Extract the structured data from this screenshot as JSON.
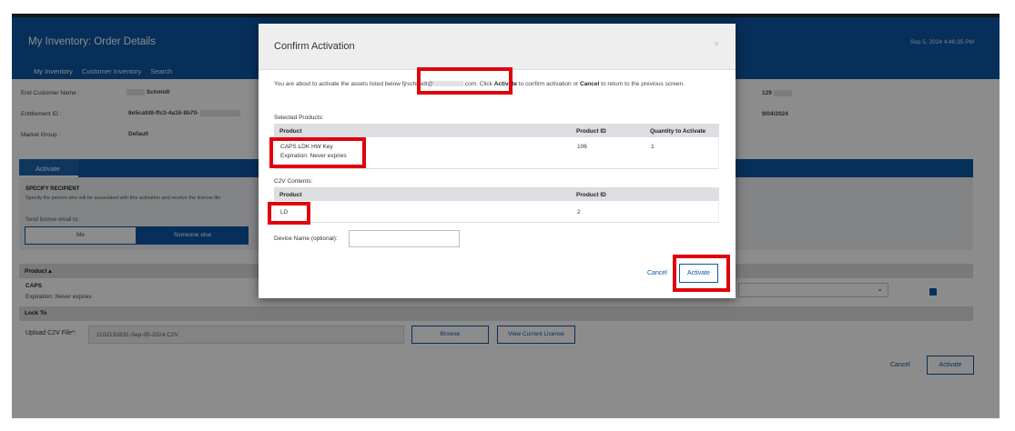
{
  "header": {
    "title": "My Inventory: Order Details",
    "datetime": "Sep 5, 2024 4:46:35 PM",
    "nav": [
      "My Inventory",
      "Customer Inventory",
      "Search"
    ]
  },
  "details": {
    "end_customer_label": "End Customer Name :",
    "end_customer_value": "Schmidt",
    "entitlement_label": "Entitlement ID :",
    "entitlement_value": "8e5cafd8-ffc3-4a16-8b70-",
    "market_group_label": "Market Group :",
    "market_group_value": "Default",
    "right_value_1": "129",
    "right_value_2": "9/04/2024"
  },
  "activate_tab": {
    "label": "Activate"
  },
  "recipient": {
    "heading": "SPECIFY RECIPIENT",
    "description": "Specify the person who will be associated with this activation and receive the license file",
    "send_label": "Send license email to:",
    "me_label": "Me",
    "someone_label": "Someone else"
  },
  "product_section": {
    "header": "Product ▴",
    "name": "CAPS",
    "expiration": "Expiration: Never expires"
  },
  "lock_to": {
    "header": "Lock To",
    "upload_label": "Upload C2V File",
    "required_mark": "*",
    "upload_colon": ":",
    "file_value": "1102131631-Sep-05-2024.C2V",
    "browse_label": "Browse",
    "view_license_label": "View Current License"
  },
  "page_actions": {
    "cancel": "Cancel",
    "activate": "Activate"
  },
  "modal": {
    "title": "Confirm Activation",
    "close": "×",
    "text_1": "You are about to activate the assets listed below f",
    "text_email": "jrschmidt@",
    "text_2": ".com. ",
    "text_click": "Click ",
    "text_activate": "Activate",
    "text_3": " to confirm activation or ",
    "text_cancel": "Cancel",
    "text_4": " to return to the previous screen.",
    "selected_label": "Selected Products:",
    "selected_columns": [
      "Product",
      "Product ID",
      "Quantity to Activate"
    ],
    "selected_row": {
      "product": "CAPS LDK HW Key",
      "expiration": "Expiration: Never expires",
      "product_id": "106",
      "quantity": "1"
    },
    "c2v_label": "C2V Contents:",
    "c2v_columns": [
      "Product",
      "Product ID"
    ],
    "c2v_row": {
      "product": "LD",
      "product_id": "2"
    },
    "device_label": "Device Name (optional):",
    "device_value": "",
    "cancel": "Cancel",
    "activate": "Activate"
  },
  "colors": {
    "brand_blue": "#0b57a4",
    "highlight_red": "#e0000b",
    "overlay": "rgba(0,0,0,0.45)"
  }
}
